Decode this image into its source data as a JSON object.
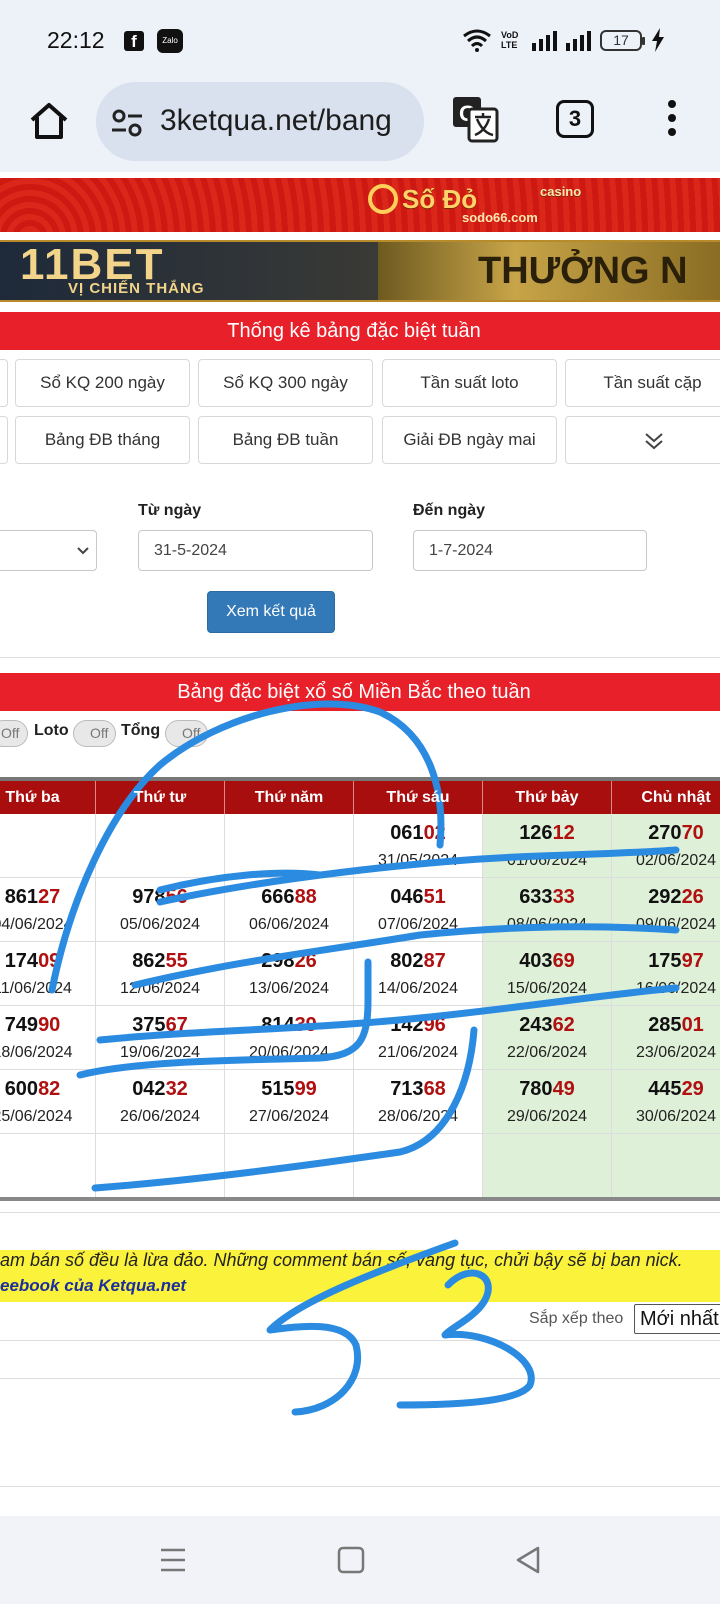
{
  "status_bar": {
    "time": "22:12",
    "apps": [
      "facebook-icon",
      "zalo-icon"
    ],
    "zalo_label": "Zalo",
    "volte_label": "VoD LTE",
    "battery": "17"
  },
  "browser": {
    "url": "3ketqua.net/bang",
    "tab_count": "3",
    "icons": [
      "home-icon",
      "site-settings-icon",
      "translate-icon",
      "tabs-icon",
      "more-vert-icon"
    ]
  },
  "banners": {
    "sodo_brand": "Số Đỏ",
    "sodo_casino": "casino",
    "sodo_url": "sodo66.com",
    "bet_brand": "11BET",
    "bet_slogan": "VỊ CHIẾN THẮNG",
    "bet_promo": "THƯỞNG N"
  },
  "section_title_1": "Thống kê bảng đặc biệt tuần",
  "nav_row_1": [
    "Sổ KQ 200 ngày",
    "Sổ KQ 300 ngày",
    "Tần suất loto",
    "Tần suất cặp"
  ],
  "nav_row_2": [
    "Bảng ĐB tháng",
    "Bảng ĐB tuần",
    "Giải ĐB ngày mai"
  ],
  "form": {
    "from_label": "Từ ngày",
    "from_value": "31-5-2024",
    "to_label": "Đến ngày",
    "to_value": "1-7-2024",
    "submit": "Xem kết quả"
  },
  "section_title_2": "Bảng đặc biệt xổ số Miền Bắc theo tuần",
  "toggles": {
    "off": "Off",
    "loto_label": "Loto",
    "tong_label": "Tổng"
  },
  "table": {
    "headers": [
      "Thứ ba",
      "Thứ tư",
      "Thứ năm",
      "Thứ sáu",
      "Thứ bảy",
      "Chủ nhật"
    ],
    "rows": [
      [
        null,
        null,
        null,
        {
          "head": "061",
          "tail": "02",
          "date": "31/05/2024"
        },
        {
          "head": "126",
          "tail": "12",
          "date": "01/06/2024"
        },
        {
          "head": "270",
          "tail": "70",
          "date": "02/06/2024"
        }
      ],
      [
        {
          "head": "861",
          "tail": "27",
          "date": "04/06/2024"
        },
        {
          "head": "978",
          "tail": "56",
          "date": "05/06/2024"
        },
        {
          "head": "666",
          "tail": "88",
          "date": "06/06/2024"
        },
        {
          "head": "046",
          "tail": "51",
          "date": "07/06/2024"
        },
        {
          "head": "633",
          "tail": "33",
          "date": "08/06/2024"
        },
        {
          "head": "292",
          "tail": "26",
          "date": "09/06/2024"
        }
      ],
      [
        {
          "head": "174",
          "tail": "09",
          "date": "11/06/2024"
        },
        {
          "head": "862",
          "tail": "55",
          "date": "12/06/2024"
        },
        {
          "head": "298",
          "tail": "26",
          "date": "13/06/2024"
        },
        {
          "head": "802",
          "tail": "87",
          "date": "14/06/2024"
        },
        {
          "head": "403",
          "tail": "69",
          "date": "15/06/2024"
        },
        {
          "head": "175",
          "tail": "97",
          "date": "16/06/2024"
        }
      ],
      [
        {
          "head": "749",
          "tail": "90",
          "date": "18/06/2024"
        },
        {
          "head": "375",
          "tail": "67",
          "date": "19/06/2024"
        },
        {
          "head": "814",
          "tail": "39",
          "date": "20/06/2024"
        },
        {
          "head": "142",
          "tail": "96",
          "date": "21/06/2024"
        },
        {
          "head": "243",
          "tail": "62",
          "date": "22/06/2024"
        },
        {
          "head": "285",
          "tail": "01",
          "date": "23/06/2024"
        }
      ],
      [
        {
          "head": "600",
          "tail": "82",
          "date": "25/06/2024"
        },
        {
          "head": "042",
          "tail": "32",
          "date": "26/06/2024"
        },
        {
          "head": "515",
          "tail": "99",
          "date": "27/06/2024"
        },
        {
          "head": "713",
          "tail": "68",
          "date": "28/06/2024"
        },
        {
          "head": "780",
          "tail": "49",
          "date": "29/06/2024"
        },
        {
          "head": "445",
          "tail": "29",
          "date": "30/06/2024"
        }
      ],
      [
        null,
        null,
        null,
        null,
        null,
        null
      ]
    ]
  },
  "notice": {
    "line1": "am bán số đều là lừa đảo. Những comment bán số, văng tục, chửi bậy sẽ bị ban nick.",
    "line2": "eebook của Ketqua.net"
  },
  "sort": {
    "label": "Sắp xếp theo",
    "value": "Mới nhất"
  },
  "colors": {
    "red_header": "#e8202a",
    "table_header": "#a80e0e",
    "weekend_bg": "#dff0d8",
    "tail_digits": "#b01010",
    "button_blue": "#3378b7",
    "notice_yellow": "#fbf33b",
    "scribble_blue": "#2b8be0"
  }
}
